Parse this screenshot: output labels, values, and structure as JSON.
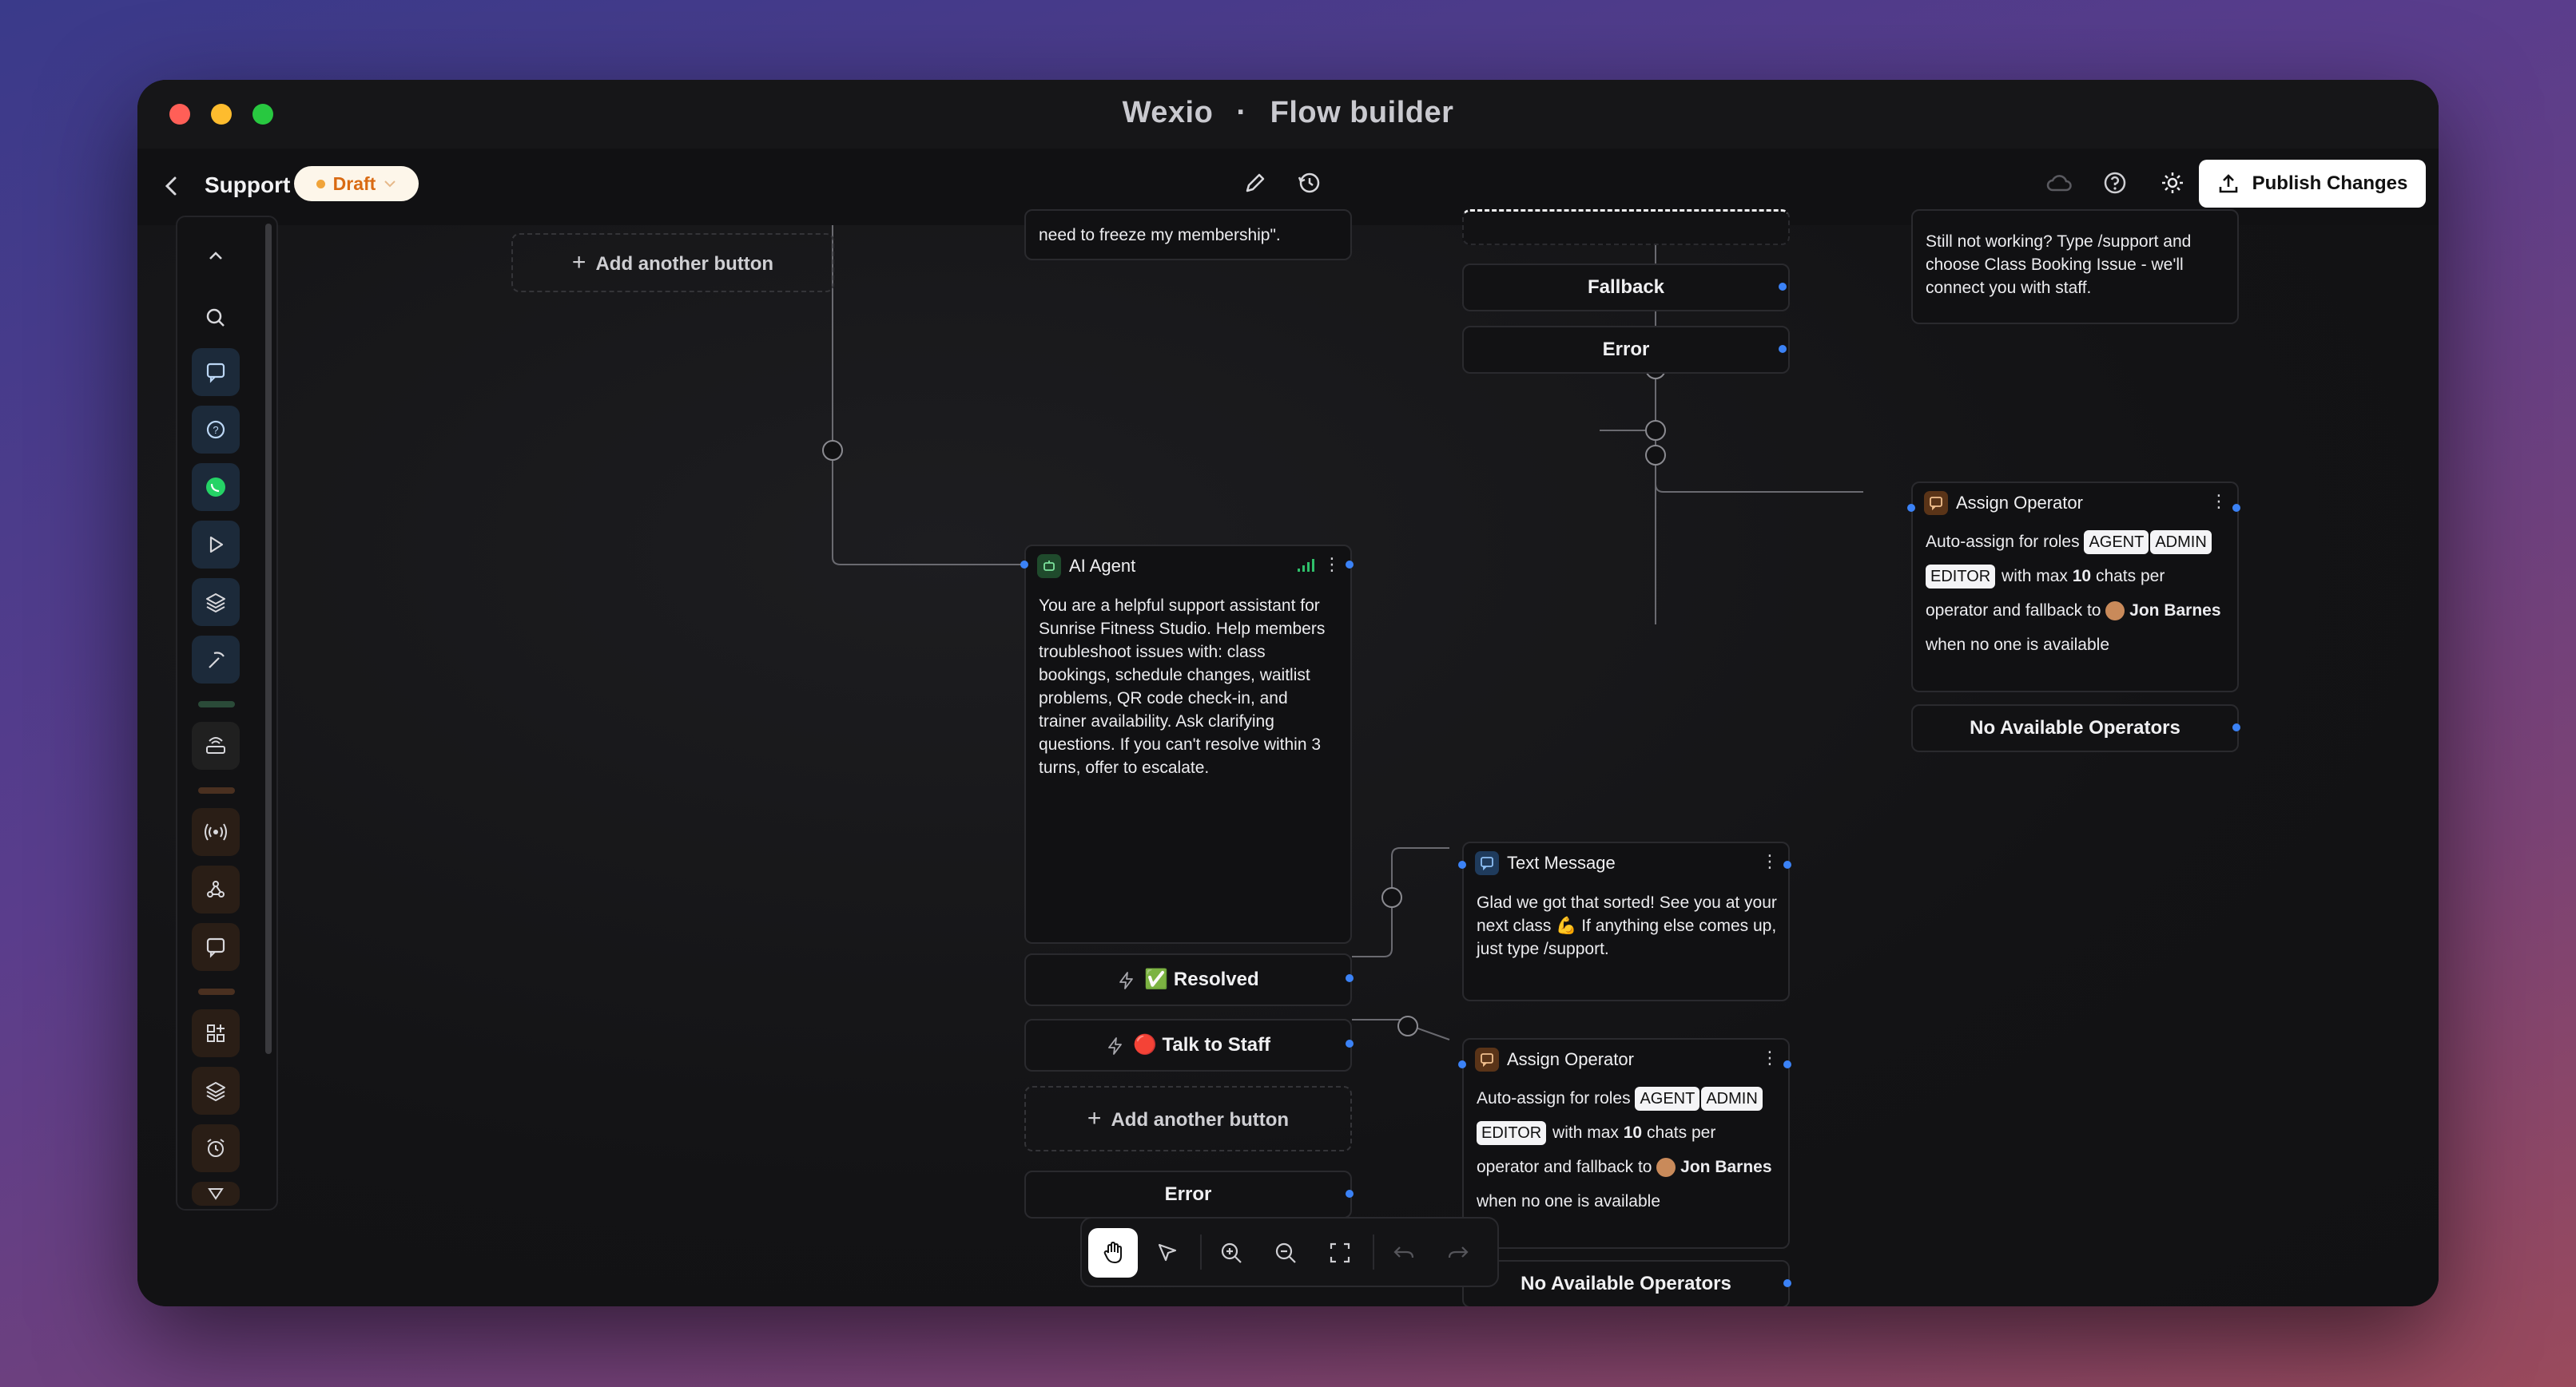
{
  "window": {
    "app_name": "Wexio",
    "separator": "·",
    "page_name": "Flow builder"
  },
  "topbar": {
    "flow_name": "Support",
    "status_badge": "Draft",
    "publish_label": "Publish Changes"
  },
  "canvas": {
    "top_left_add_button": "Add another button",
    "partial_message_text": "need to freeze my membership\".",
    "fallback_label": "Fallback",
    "error_label_top": "Error",
    "still_not_working_text": "Still not working? Type /support and choose Class Booking Issue - we'll connect you with staff.",
    "assign_top": {
      "title": "Assign Operator",
      "prefix": "Auto-assign for roles",
      "roles": [
        "AGENT",
        "ADMIN",
        "EDITOR"
      ],
      "mid": "with max",
      "max": "10",
      "suffix": "chats per operator and fallback to",
      "fallback_person": "Jon Barnes",
      "tail": "when no one is available"
    },
    "no_available_top": "No Available Operators",
    "ai_agent": {
      "title": "AI Agent",
      "text": "You are a helpful support assistant for Sunrise Fitness Studio. Help members troubleshoot issues with: class bookings, schedule changes, waitlist problems, QR code check-in, and trainer availability. Ask clarifying questions. If you can't resolve within 3 turns, offer to escalate."
    },
    "resolved_label": "✅ Resolved",
    "talk_to_staff_label": "🔴 Talk to Staff",
    "add_another_button": "Add another button",
    "error_label_bottom": "Error",
    "text_message": {
      "title": "Text Message",
      "text": "Glad we got that sorted! See you at your next class 💪 If anything else comes up, just type /support."
    },
    "assign_bottom": {
      "title": "Assign Operator",
      "prefix": "Auto-assign for roles",
      "roles": [
        "AGENT",
        "ADMIN",
        "EDITOR"
      ],
      "mid": "with max",
      "max": "10",
      "suffix": "chats per operator and fallback to",
      "fallback_person": "Jon Barnes",
      "tail": "when no one is available"
    },
    "no_available_bottom": "No Available Operators"
  },
  "sidebar_icons": [
    "chevron-up-icon",
    "search-icon",
    "chat-icon",
    "question-chat-icon",
    "whatsapp-icon",
    "play-icon",
    "layers-icon",
    "pickaxe-icon",
    "router-icon",
    "broadcast-icon",
    "webhook-icon",
    "message-square-icon",
    "widget-icon",
    "layers-icon",
    "alarm-icon"
  ],
  "colors": {
    "accent": "#3b82f6",
    "draft": "#e07b1a",
    "whatsapp": "#25d366"
  }
}
